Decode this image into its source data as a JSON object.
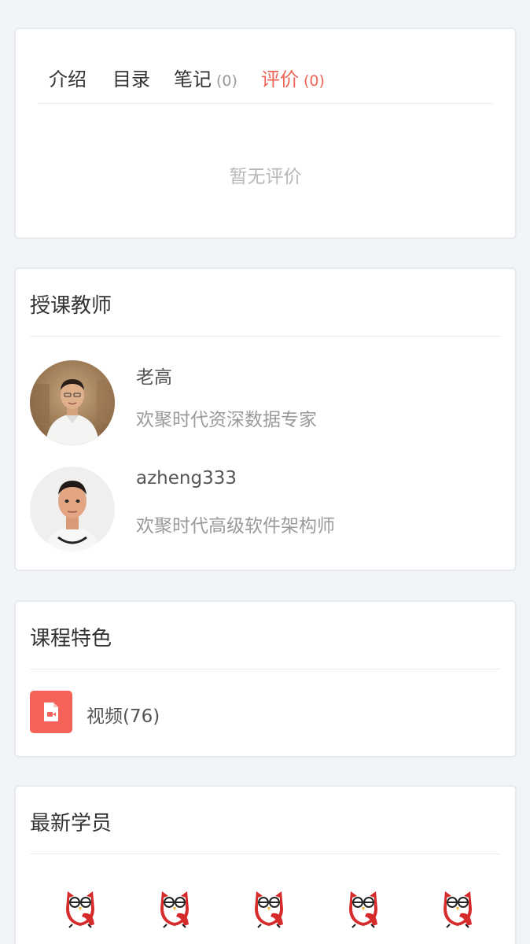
{
  "tabs": {
    "items": [
      {
        "label": "介绍",
        "count": ""
      },
      {
        "label": "目录",
        "count": ""
      },
      {
        "label": "笔记",
        "count": "(0)"
      },
      {
        "label": "评价",
        "count": "(0)"
      }
    ],
    "active_index": 3,
    "empty_text": "暂无评价"
  },
  "teachers": {
    "title": "授课教师",
    "items": [
      {
        "name": "老高",
        "description": "欢聚时代资深数据专家"
      },
      {
        "name": "azheng333",
        "description": "欢聚时代高级软件架构师"
      }
    ]
  },
  "features": {
    "title": "课程特色",
    "items": [
      {
        "label": "视频(76)",
        "icon": "video-file-icon"
      }
    ]
  },
  "students": {
    "title": "最新学员",
    "avatar_icon": "owl-mascot-icon",
    "avatar_count": 5
  },
  "colors": {
    "accent": "#f06356",
    "feature_icon_bg": "#f5625a",
    "page_bg": "#f2f5f8"
  }
}
